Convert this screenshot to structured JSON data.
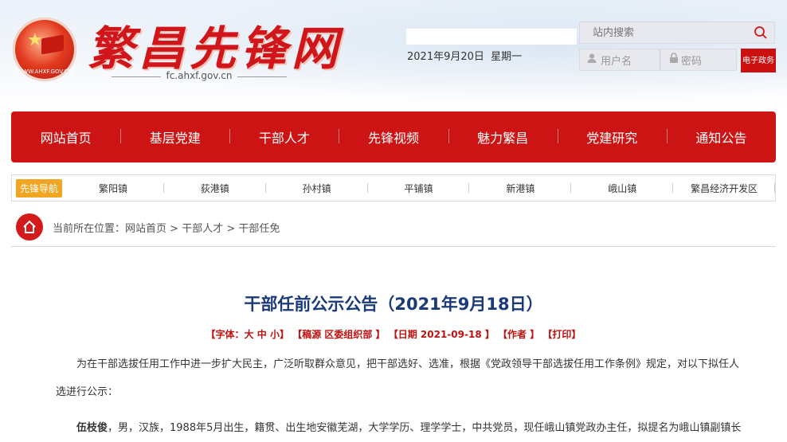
{
  "site": {
    "title": "繁昌先锋网",
    "domain": "fc.ahxf.gov.cn",
    "emblem_url": "WWW.AHXF.GOV.CN",
    "date": "2021年9月20日",
    "weekday": "星期一"
  },
  "search": {
    "placeholder": "站内搜索"
  },
  "login": {
    "username_placeholder": "用户名",
    "password_placeholder": "密码"
  },
  "egov": {
    "label": "电子政务"
  },
  "nav": {
    "items": [
      "网站首页",
      "基层党建",
      "干部人才",
      "先锋视频",
      "魅力繁昌",
      "党建研究",
      "通知公告"
    ]
  },
  "subnav": {
    "tag": "先锋导航",
    "items": [
      "繁阳镇",
      "荻港镇",
      "孙村镇",
      "平铺镇",
      "新港镇",
      "峨山镇",
      "繁昌经济开发区"
    ]
  },
  "breadcrumb": {
    "prefix": "当前所在位置：",
    "items": [
      "网站首页",
      "干部人才",
      "干部任免"
    ],
    "separator": " > "
  },
  "article": {
    "title": "干部任前公示公告（2021年9月18日）",
    "meta": {
      "font_label": "【字体：",
      "font_large": "大",
      "font_mid": "中",
      "font_small": "小",
      "font_close": "】",
      "source": "【稿源 区委组织部 】",
      "date": "【日期 2021-09-18 】",
      "author": "【作者 】",
      "print": "【打印】"
    },
    "para1": "为在干部选拔任用工作中进一步扩大民主，广泛听取群众意见，把干部选好、选准，根据《党政领导干部选拔任用工作条例》规定，对以下拟任人选进行公示：",
    "para2_name": "伍枝俊",
    "para2_text": "，男，汉族，1988年5月出生，籍贯、出生地安徽芜湖，大学学历、理学学士，中共党员，现任峨山镇党政办主任，拟提名为峨山镇副镇长"
  }
}
